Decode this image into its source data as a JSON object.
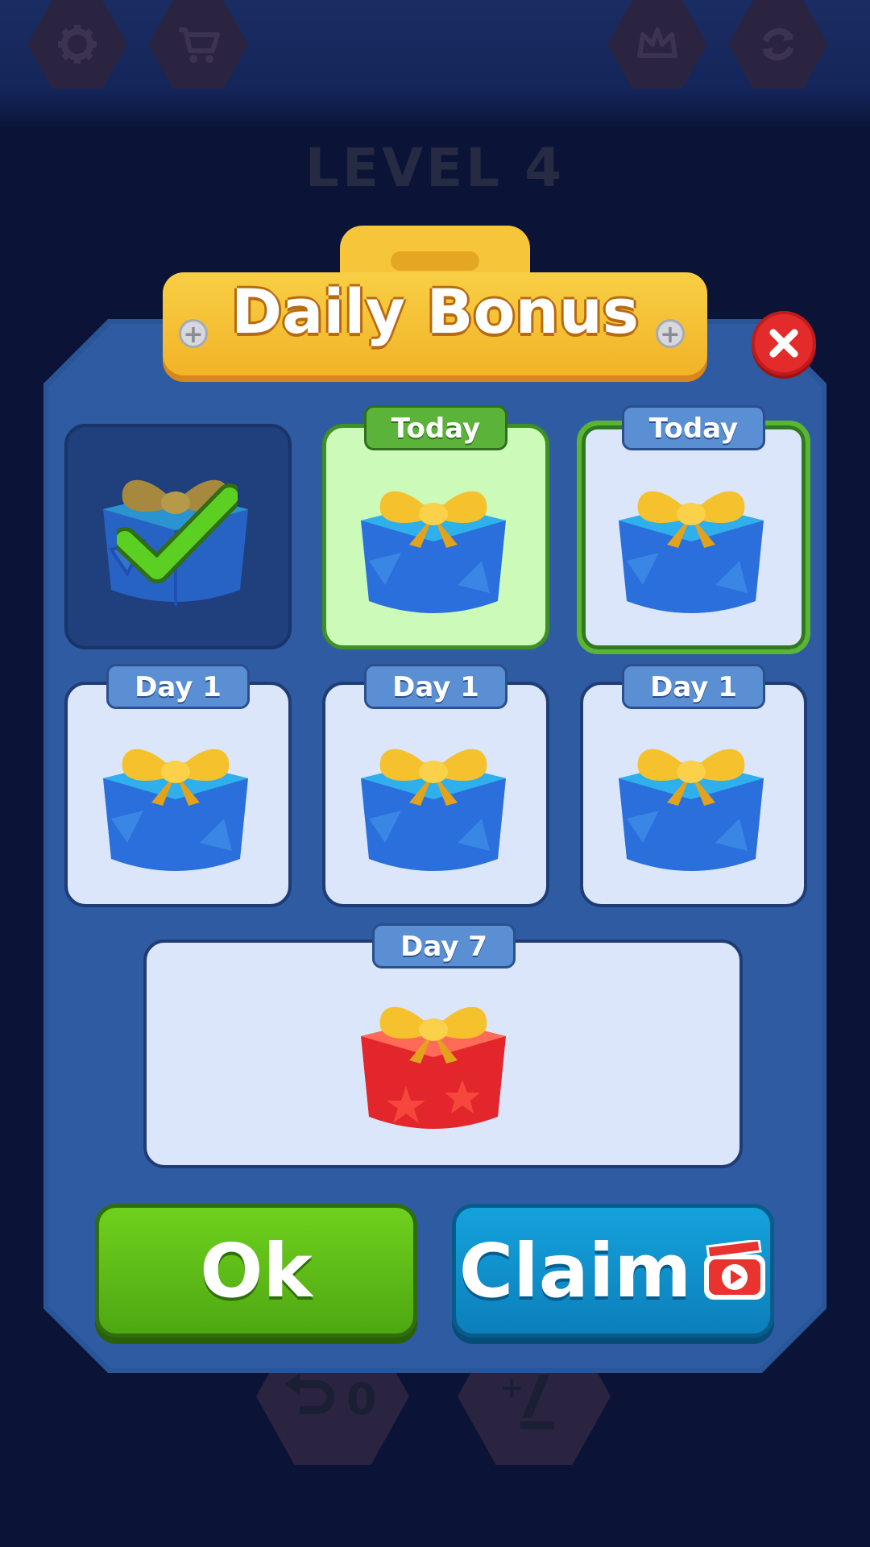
{
  "hud": {
    "level_label": "LEVEL 4",
    "undo_count": "0",
    "icons": [
      "gear-icon",
      "cart-icon",
      "crown-icon",
      "refresh-icon",
      "undo-icon",
      "add-piece-icon"
    ]
  },
  "dialog": {
    "title": "Daily Bonus",
    "close_icon": "close-icon",
    "rewards": [
      {
        "label": "",
        "state": "claimed",
        "gift_color": "blue"
      },
      {
        "label": "Today",
        "state": "today",
        "gift_color": "blue"
      },
      {
        "label": "Today",
        "state": "today-selected",
        "gift_color": "blue"
      },
      {
        "label": "Day 1",
        "state": "locked",
        "gift_color": "blue"
      },
      {
        "label": "Day 1",
        "state": "locked",
        "gift_color": "blue"
      },
      {
        "label": "Day 1",
        "state": "locked",
        "gift_color": "blue"
      },
      {
        "label": "Day 7",
        "state": "locked",
        "gift_color": "red"
      }
    ],
    "buttons": {
      "ok_label": "Ok",
      "claim_label": "Claim",
      "claim_icon": "video-ad-icon"
    }
  },
  "colors": {
    "background": "#0b1437",
    "panel": "#2e5ba2",
    "title_plate": "#f6c53a",
    "ok_button": "#5cba17",
    "claim_button": "#1195cf",
    "close_button": "#e42b2b"
  }
}
